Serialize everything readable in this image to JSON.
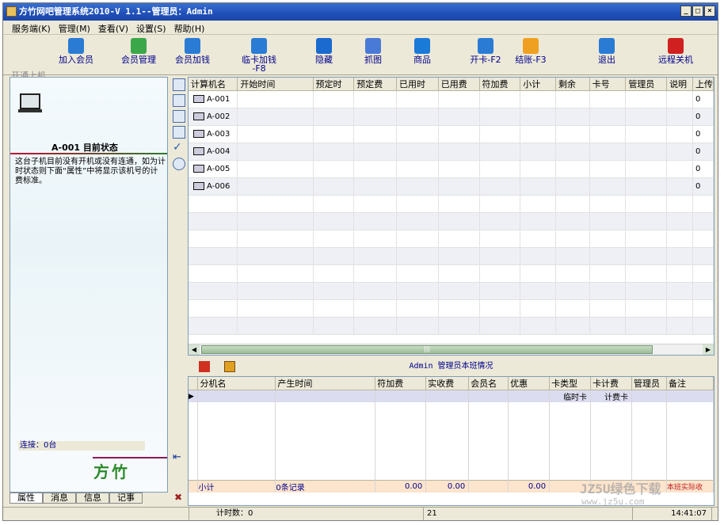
{
  "window": {
    "title": "方竹网吧管理系统2010-V 1.1--管理员：Admin"
  },
  "window_buttons": [
    "_",
    "□",
    "×"
  ],
  "menu": [
    {
      "label": "服务端(K)"
    },
    {
      "label": "管理(M)"
    },
    {
      "label": "查看(V)"
    },
    {
      "label": "设置(S)"
    },
    {
      "label": "帮助(H)"
    }
  ],
  "toolbar": [
    {
      "label": "开通上机",
      "icon": "open-computer-icon",
      "enabled": false,
      "color": "#8a8a8a"
    },
    {
      "label": "加入会员",
      "icon": "add-member-icon",
      "enabled": true,
      "color": "#2a7bd4"
    },
    {
      "label": "会员管理",
      "icon": "member-manage-icon",
      "enabled": true,
      "color": "#3aa84a"
    },
    {
      "label": "会员加钱",
      "icon": "member-recharge-icon",
      "enabled": true,
      "color": "#2a7bd4"
    },
    {
      "label": "临卡加钱\n-F8",
      "icon": "temp-card-recharge-icon",
      "enabled": true,
      "color": "#2a7bd4"
    },
    {
      "label": "隐藏",
      "icon": "hide-icon",
      "enabled": true,
      "color": "#1a6ad0"
    },
    {
      "label": "抓图",
      "icon": "screenshot-icon",
      "enabled": true,
      "color": "#4a7ad8"
    },
    {
      "label": "商品",
      "icon": "cart-icon",
      "enabled": true,
      "color": "#1a7ad8"
    },
    {
      "label": "开卡-F2",
      "icon": "open-card-icon",
      "enabled": true,
      "color": "#2a7bd4"
    },
    {
      "label": "结账-F3",
      "icon": "checkout-icon",
      "enabled": true,
      "color": "#f0a020"
    },
    {
      "label": "退出",
      "icon": "exit-icon",
      "enabled": true,
      "color": "#2a7bd4"
    },
    {
      "label": "远程关机",
      "icon": "remote-shutdown-icon",
      "enabled": true,
      "color": "#d02020"
    }
  ],
  "left_panel": {
    "status_title": "A-001 目前状态",
    "description": "这台子机目前没有开机或没有连通，如为计时状态则下面“属性”中将显示该机号的计费标准。",
    "connection": "连接：0台",
    "logo_text": "方竹"
  },
  "bottom_tabs": [
    {
      "label": "属性"
    },
    {
      "label": "消息"
    },
    {
      "label": "信息"
    },
    {
      "label": "记事"
    }
  ],
  "side_tools": [
    "layout-icon",
    "grid-icon",
    "calendar-icon",
    "list-icon",
    "check-icon",
    "clock-icon"
  ],
  "main_grid": {
    "columns": [
      "计算机名",
      "开始时间",
      "预定时",
      "预定费",
      "已用时",
      "已用费",
      "符加费",
      "小计",
      "剩余",
      "卡号",
      "管理员",
      "说明",
      "上传"
    ],
    "rows": [
      {
        "name": "A-001",
        "last": "0"
      },
      {
        "name": "A-002",
        "last": "0"
      },
      {
        "name": "A-003",
        "last": "0"
      },
      {
        "name": "A-004",
        "last": "0"
      },
      {
        "name": "A-005",
        "last": "0"
      },
      {
        "name": "A-006",
        "last": "0"
      }
    ],
    "scroll_thumb_label": "|||"
  },
  "shift": {
    "title": "Admin 管理员本班情况",
    "columns": [
      "分机名",
      "产生时间",
      "符加费",
      "实收费",
      "会员名",
      "优惠",
      "卡类型",
      "卡计费",
      "管理员",
      "备注"
    ],
    "selected_row": {
      "marker": "▶",
      "card_type": "临时卡",
      "card_billing": "计费卡"
    },
    "summary": {
      "label": "小计",
      "records": "0条记录",
      "extra_fee": "0.00",
      "received": "0.00",
      "discount": "0.00",
      "note": "本班实际收"
    }
  },
  "status_bar": {
    "timer_count": "计时数：0",
    "value": "21",
    "time": "14:41:07"
  },
  "watermark": {
    "line1": "JZ5U绿色下载",
    "line2": "www.jz5u.com"
  }
}
